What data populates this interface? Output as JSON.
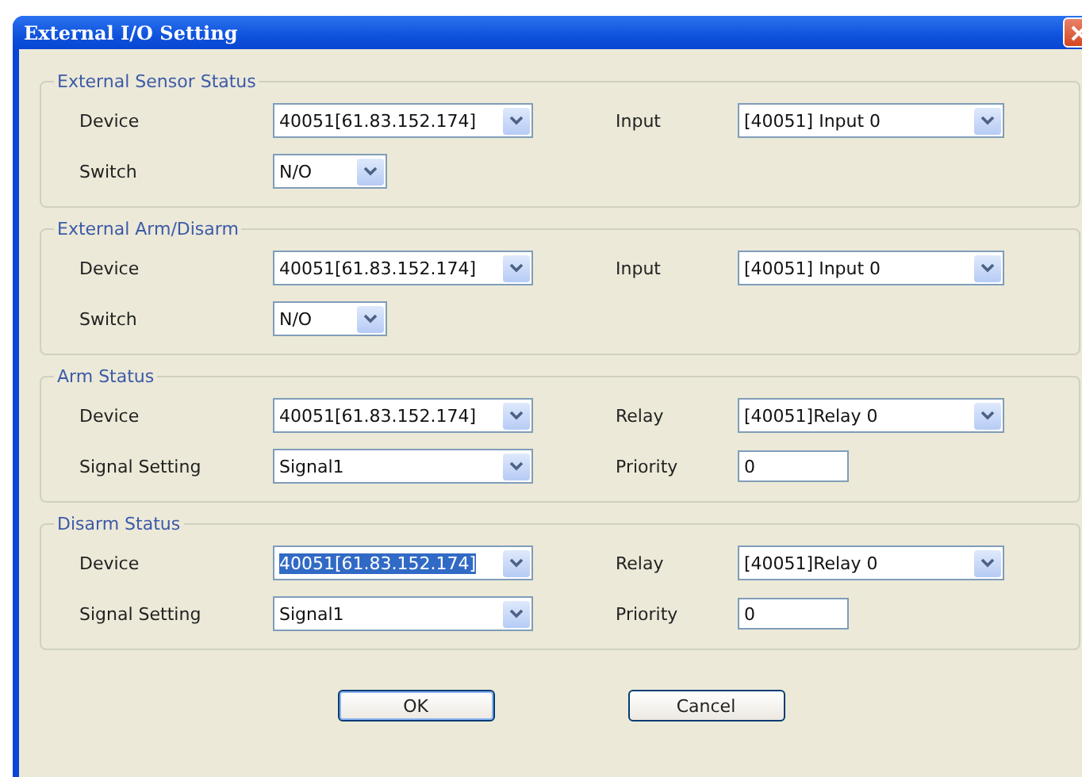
{
  "window": {
    "title": "External I/O Setting"
  },
  "groups": [
    {
      "title": "External Sensor Status",
      "rows": [
        [
          {
            "label": "Device",
            "kind": "dropdown",
            "value": "40051[61.83.152.174]",
            "highlighted": false
          },
          {
            "label": "Input",
            "kind": "dropdown",
            "value": "[40051] Input 0",
            "highlighted": false
          }
        ],
        [
          {
            "label": "Switch",
            "kind": "small-dropdown",
            "value": "N/O",
            "highlighted": false
          }
        ]
      ]
    },
    {
      "title": "External Arm/Disarm",
      "rows": [
        [
          {
            "label": "Device",
            "kind": "dropdown",
            "value": "40051[61.83.152.174]",
            "highlighted": false
          },
          {
            "label": "Input",
            "kind": "dropdown",
            "value": "[40051] Input 0",
            "highlighted": false
          }
        ],
        [
          {
            "label": "Switch",
            "kind": "small-dropdown",
            "value": "N/O",
            "highlighted": false
          }
        ]
      ]
    },
    {
      "title": "Arm Status",
      "rows": [
        [
          {
            "label": "Device",
            "kind": "dropdown",
            "value": "40051[61.83.152.174]",
            "highlighted": false
          },
          {
            "label": "Relay",
            "kind": "dropdown",
            "value": "[40051]Relay 0",
            "highlighted": false
          }
        ],
        [
          {
            "label": "Signal Setting",
            "kind": "dropdown",
            "value": "Signal1",
            "highlighted": false
          },
          {
            "label": "Priority",
            "kind": "textbox",
            "value": "0",
            "highlighted": false
          }
        ]
      ]
    },
    {
      "title": "Disarm Status",
      "rows": [
        [
          {
            "label": "Device",
            "kind": "dropdown",
            "value": "40051[61.83.152.174]",
            "highlighted": true
          },
          {
            "label": "Relay",
            "kind": "dropdown",
            "value": "[40051]Relay 0",
            "highlighted": false
          }
        ],
        [
          {
            "label": "Signal Setting",
            "kind": "dropdown",
            "value": "Signal1",
            "highlighted": false
          },
          {
            "label": "Priority",
            "kind": "textbox",
            "value": "0",
            "highlighted": false
          }
        ]
      ]
    }
  ],
  "buttons": [
    "OK",
    "Cancel"
  ]
}
